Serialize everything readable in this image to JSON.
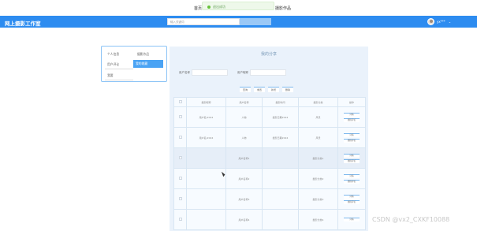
{
  "topnav": {
    "home": "首页",
    "photo": "摄影作品"
  },
  "toast": {
    "text": "退出成功"
  },
  "header": {
    "brand": "网上摄影工作室",
    "search_placeholder": "输入关键词",
    "user_name": "yx***",
    "caret": "⌄"
  },
  "sidebar": {
    "items": [
      {
        "label": "个人信息"
      },
      {
        "label": "摄影作品"
      },
      {
        "label": "用户评论"
      },
      {
        "label": "我的收藏"
      },
      {
        "label": "我要"
      }
    ]
  },
  "panel": {
    "title": "我的分享",
    "filters": {
      "user_label": "用户名称",
      "name_label": "用户昵称"
    },
    "buttons": [
      {
        "label": "查询"
      },
      {
        "label": "重置"
      },
      {
        "label": "新增"
      },
      {
        "label": "删除"
      }
    ],
    "table": {
      "headers": [
        "",
        "摄影昵称",
        "用户名称",
        "摄影时间",
        "摄影分类",
        "操作"
      ],
      "rows": [
        {
          "c1": "用户名/2024",
          "c2": "人物",
          "c3": "摄影日期2024",
          "c4": "风景",
          "c5": "",
          "actions": [
            "详情",
            "删除评论"
          ]
        },
        {
          "c1": "用户名/2024",
          "c2": "人物",
          "c3": "摄影日期2024",
          "c4": "风景",
          "c5": "",
          "actions": [
            "详情",
            "删除评论"
          ]
        },
        {
          "c1": "",
          "c2": "用户名称1",
          "c3": "",
          "c4": "摄影分类1",
          "c5": "",
          "actions": [
            "详情",
            "删除评论"
          ]
        },
        {
          "c1": "",
          "c2": "用户名称2",
          "c3": "",
          "c4": "摄影分类2",
          "c5": "",
          "actions": [
            "详情",
            "删除评论"
          ]
        },
        {
          "c1": "",
          "c2": "用户名称3",
          "c3": "",
          "c4": "摄影分类3",
          "c5": "",
          "actions": [
            "详情",
            "删除评论"
          ]
        },
        {
          "c1": "",
          "c2": "用户名称4",
          "c3": "",
          "c4": "摄影分类4",
          "c5": "",
          "actions": [
            "详情"
          ]
        }
      ]
    }
  },
  "watermark": "CSDN @vx2_CXKF10088"
}
